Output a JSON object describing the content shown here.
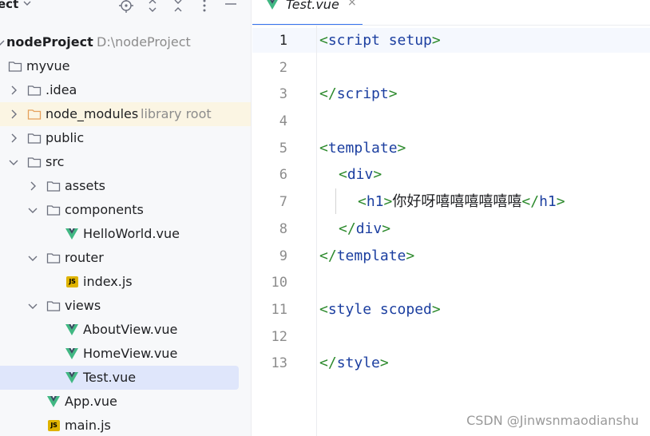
{
  "panel": {
    "title": "ect",
    "tree": [
      {
        "id": "node-project",
        "label": "nodeProject",
        "hint": "D:\\nodeProject",
        "icon": "folder-icon",
        "expanded": true
      },
      {
        "id": "myvue",
        "label": "myvue",
        "icon": "folder-icon"
      },
      {
        "id": "idea",
        "label": ".idea",
        "icon": "folder-icon",
        "expanded": false
      },
      {
        "id": "node-modules",
        "label": "node_modules",
        "hint": "library root",
        "icon": "folder-icon",
        "expanded": false
      },
      {
        "id": "public",
        "label": "public",
        "icon": "folder-icon",
        "expanded": false
      },
      {
        "id": "src",
        "label": "src",
        "icon": "folder-icon",
        "expanded": true
      },
      {
        "id": "assets",
        "label": "assets",
        "icon": "folder-icon",
        "expanded": false
      },
      {
        "id": "components",
        "label": "components",
        "icon": "folder-icon",
        "expanded": true
      },
      {
        "id": "helloworld",
        "label": "HelloWorld.vue",
        "icon": "vue-icon"
      },
      {
        "id": "router",
        "label": "router",
        "icon": "folder-icon",
        "expanded": true
      },
      {
        "id": "index-js",
        "label": "index.js",
        "icon": "js-icon",
        "badge": "JS"
      },
      {
        "id": "views",
        "label": "views",
        "icon": "folder-icon",
        "expanded": true
      },
      {
        "id": "aboutview",
        "label": "AboutView.vue",
        "icon": "vue-icon"
      },
      {
        "id": "homeview",
        "label": "HomeView.vue",
        "icon": "vue-icon"
      },
      {
        "id": "test-vue",
        "label": "Test.vue",
        "icon": "vue-icon",
        "selected": true
      },
      {
        "id": "app-vue",
        "label": "App.vue",
        "icon": "vue-icon"
      },
      {
        "id": "main-js",
        "label": "main.js",
        "icon": "js-icon",
        "badge": "JS"
      }
    ]
  },
  "editor": {
    "tab": {
      "label": "Test.vue",
      "close": "×"
    },
    "line_numbers": [
      "1",
      "2",
      "3",
      "4",
      "5",
      "6",
      "7",
      "8",
      "9",
      "10",
      "11",
      "12",
      "13"
    ],
    "code": {
      "l1_open": "<",
      "l1_tag": "script",
      "l1_attr": " setup",
      "l1_close": ">",
      "l3_open": "</",
      "l3_tag": "script",
      "l3_close": ">",
      "l5_open": "<",
      "l5_tag": "template",
      "l5_close": ">",
      "l6_open": "<",
      "l6_tag": "div",
      "l6_close": ">",
      "l7_open": "<",
      "l7_tag": "h1",
      "l7_close": ">",
      "l7_text": "你好呀嘻嘻嘻嘻嘻嘻",
      "l7_endopen": "</",
      "l7_endtag": "h1",
      "l7_endclose": ">",
      "l8_open": "</",
      "l8_tag": "div",
      "l8_close": ">",
      "l9_open": "</",
      "l9_tag": "template",
      "l9_close": ">",
      "l11_open": "<",
      "l11_tag": "style",
      "l11_attr": " scoped",
      "l11_close": ">",
      "l13_open": "</",
      "l13_tag": "style",
      "l13_close": ">"
    }
  },
  "watermark": "CSDN @Jinwsnmaodianshu",
  "colors": {
    "accent": "#3574f0",
    "vue_green": "#41b883",
    "vue_dark": "#35495e",
    "folder_stroke": "#6c707e",
    "library_folder": "#e5a05a",
    "selection": "#dfe6fb",
    "highlight": "#fbf5e3"
  }
}
